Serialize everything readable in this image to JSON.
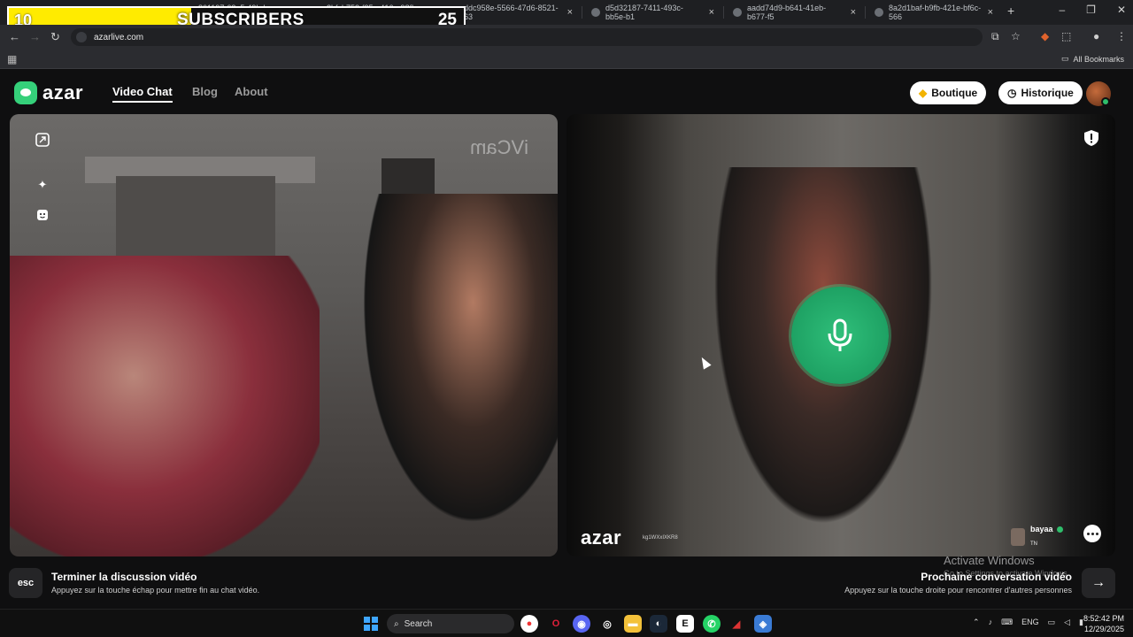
{
  "overlay": {
    "current": "10",
    "label": "SUBSCRIBERS",
    "goal": "25",
    "progress_fraction": 0.4
  },
  "browser": {
    "tabs": [
      "861197-63e5-49bd-963f-e",
      "2bfcb752-f35e-416a-98fb-aaff",
      "ddc958e-5566-47d6-8521-63",
      "d5d32187-7411-493c-bb5e-b1",
      "aadd74d9-b641-41eb-b677-f5",
      "8a2d1baf-b9fb-421e-bf6c-566"
    ],
    "url": "azarlive.com",
    "bookmarks_label": "All Bookmarks"
  },
  "azar": {
    "logo": "azar",
    "nav": [
      "Video Chat",
      "Blog",
      "About"
    ],
    "boutique": "Boutique",
    "historique": "Historique"
  },
  "remote": {
    "logo": "azar",
    "id_text": "kg1WXxIXKR8",
    "peer_name": "bayaa",
    "peer_country": "TN",
    "watermark": "iVCam"
  },
  "hints": {
    "esc_key": "esc",
    "end_title": "Terminer la discussion vidéo",
    "end_sub": "Appuyez sur la touche échap pour mettre fin au chat vidéo.",
    "next_title": "Prochaine conversation vidéo",
    "next_sub": "Appuyez sur la touche droite pour rencontrer d'autres personnes"
  },
  "watermark_os": {
    "title": "Activate Windows",
    "sub": "Go to Settings to activate Windows."
  },
  "taskbar": {
    "search": "Search",
    "lang": "ENG",
    "time": "8:52:42 PM",
    "date": "12/29/2025"
  },
  "colors": {
    "accent_green": "#2fbf7a",
    "overlay_yellow": "#ffeb00"
  }
}
